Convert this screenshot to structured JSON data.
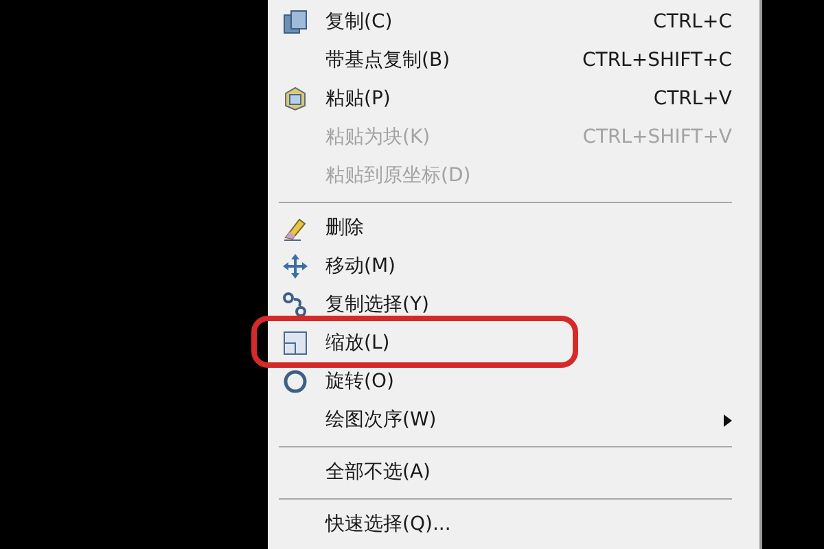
{
  "menu": {
    "items": [
      {
        "kind": "item",
        "label": "复制(C)",
        "shortcut": "CTRL+C",
        "disabled": false,
        "highlighted": false,
        "has_submenu": false
      },
      {
        "kind": "item",
        "label": "带基点复制(B)",
        "shortcut": "CTRL+SHIFT+C",
        "disabled": false,
        "highlighted": false,
        "has_submenu": false
      },
      {
        "kind": "item",
        "label": "粘贴(P)",
        "shortcut": "CTRL+V",
        "disabled": false,
        "highlighted": false,
        "has_submenu": false
      },
      {
        "kind": "item",
        "label": "粘贴为块(K)",
        "shortcut": "CTRL+SHIFT+V",
        "disabled": true,
        "highlighted": false,
        "has_submenu": false
      },
      {
        "kind": "item",
        "label": "粘贴到原坐标(D)",
        "disabled": true,
        "highlighted": false,
        "has_submenu": false
      },
      {
        "kind": "separator"
      },
      {
        "kind": "item",
        "label": "删除",
        "disabled": false,
        "highlighted": false,
        "has_submenu": false
      },
      {
        "kind": "item",
        "label": "移动(M)",
        "disabled": false,
        "highlighted": false,
        "has_submenu": false
      },
      {
        "kind": "item",
        "label": "复制选择(Y)",
        "disabled": false,
        "highlighted": false,
        "has_submenu": false
      },
      {
        "kind": "item",
        "label": "缩放(L)",
        "disabled": false,
        "highlighted": true,
        "has_submenu": false
      },
      {
        "kind": "item",
        "label": "旋转(O)",
        "disabled": false,
        "highlighted": false,
        "has_submenu": false
      },
      {
        "kind": "item",
        "label": "绘图次序(W)",
        "disabled": false,
        "highlighted": false,
        "has_submenu": true
      },
      {
        "kind": "separator"
      },
      {
        "kind": "item",
        "label": "全部不选(A)",
        "disabled": false,
        "highlighted": false,
        "has_submenu": false
      },
      {
        "kind": "separator"
      },
      {
        "kind": "item",
        "label": "快速选择(Q)...",
        "disabled": false,
        "highlighted": false,
        "has_submenu": false
      }
    ]
  }
}
